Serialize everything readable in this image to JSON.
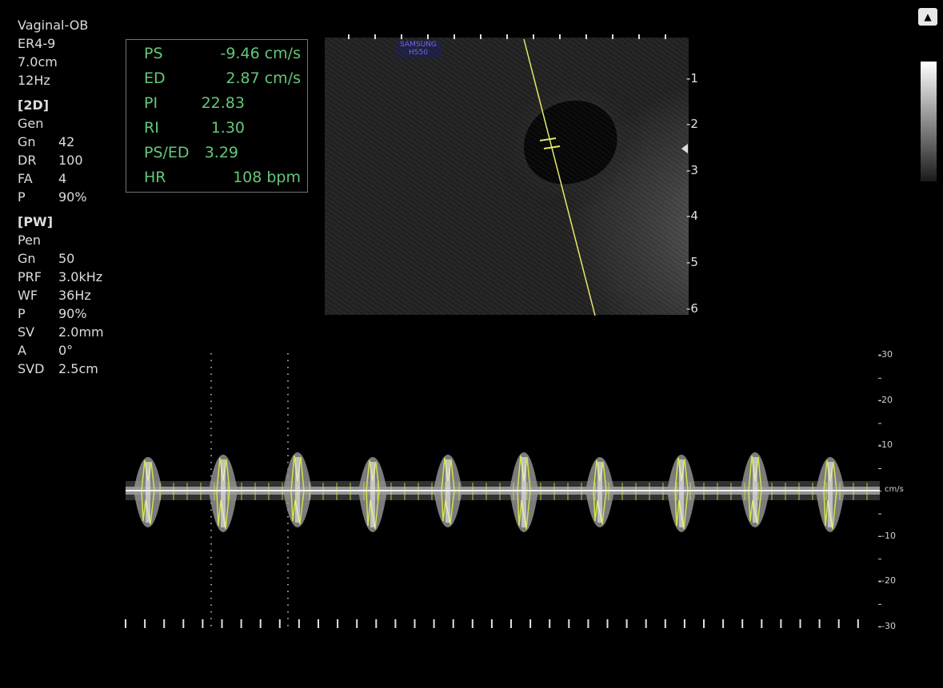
{
  "mode": {
    "preset": "Vaginal-OB",
    "probe": "ER4-9",
    "depth": "7.0cm",
    "frame_rate": "12Hz"
  },
  "params_2d": {
    "header": "[2D]",
    "preset": "Gen",
    "rows": [
      {
        "k": "Gn",
        "v": "42"
      },
      {
        "k": "DR",
        "v": "100"
      },
      {
        "k": "FA",
        "v": "4"
      },
      {
        "k": "P",
        "v": "90%"
      }
    ]
  },
  "params_pw": {
    "header": "[PW]",
    "preset": "Pen",
    "rows": [
      {
        "k": "Gn",
        "v": "50"
      },
      {
        "k": "PRF",
        "v": "3.0kHz"
      },
      {
        "k": "WF",
        "v": "36Hz"
      },
      {
        "k": "P",
        "v": "90%"
      },
      {
        "k": "SV",
        "v": "2.0mm"
      },
      {
        "k": "A",
        "v": "0°"
      },
      {
        "k": "SVD",
        "v": "2.5cm"
      }
    ]
  },
  "measurements": [
    {
      "label": "PS",
      "value": "-9.46 cm/s"
    },
    {
      "label": "ED",
      "value": "2.87 cm/s"
    },
    {
      "label": "PI",
      "value": "22.83"
    },
    {
      "label": "RI",
      "value": "1.30"
    },
    {
      "label": "PS/ED",
      "value": "3.29"
    },
    {
      "label": "HR",
      "value": "108 bpm"
    }
  ],
  "watermark": {
    "line1": "SAMSUNG",
    "line2": "HS50"
  },
  "depth_scale": [
    "1",
    "2",
    "3",
    "4",
    "5",
    "6"
  ],
  "velocity_scale": [
    "30",
    "20",
    "10",
    "-10",
    "-20",
    "-30"
  ],
  "velocity_unit": "cm/s",
  "colors": {
    "measure_text": "#63c77a",
    "trace": "#d6e24a",
    "cursor": "#e6e86a"
  },
  "icons": {
    "probe": "probe-icon",
    "focus": "focus-marker-icon"
  }
}
